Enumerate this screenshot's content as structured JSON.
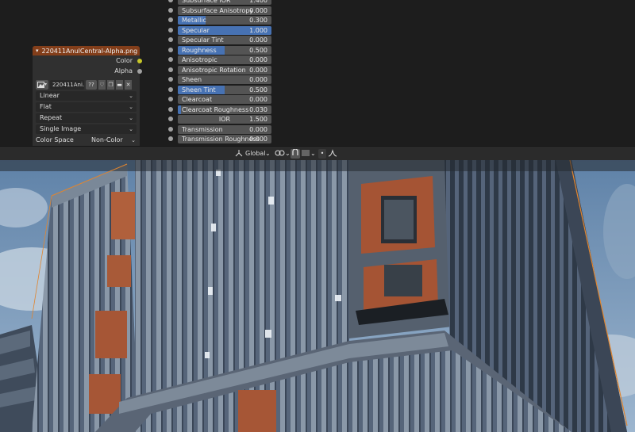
{
  "bsdf_properties": [
    {
      "label": "Subsurface IOR",
      "value": "1.400",
      "fill": 0,
      "centered": false
    },
    {
      "label": "Subsurface Anisotropy",
      "value": "0.000",
      "fill": 0,
      "centered": false
    },
    {
      "label": "Metallic",
      "value": "0.300",
      "fill": 0.3,
      "centered": false
    },
    {
      "label": "Specular",
      "value": "1.000",
      "fill": 1.0,
      "centered": false
    },
    {
      "label": "Specular Tint",
      "value": "0.000",
      "fill": 0,
      "centered": false
    },
    {
      "label": "Roughness",
      "value": "0.500",
      "fill": 0.5,
      "centered": false
    },
    {
      "label": "Anisotropic",
      "value": "0.000",
      "fill": 0,
      "centered": false
    },
    {
      "label": "Anisotropic Rotation",
      "value": "0.000",
      "fill": 0,
      "centered": false
    },
    {
      "label": "Sheen",
      "value": "0.000",
      "fill": 0,
      "centered": false
    },
    {
      "label": "Sheen Tint",
      "value": "0.500",
      "fill": 0.5,
      "centered": false
    },
    {
      "label": "Clearcoat",
      "value": "0.000",
      "fill": 0,
      "centered": false
    },
    {
      "label": "Clearcoat Roughness",
      "value": "0.030",
      "fill": 0.03,
      "centered": false
    },
    {
      "label": "IOR",
      "value": "1.500",
      "fill": 0,
      "centered": true
    },
    {
      "label": "Transmission",
      "value": "0.000",
      "fill": 0,
      "centered": false
    },
    {
      "label": "Transmission Roughness",
      "value": "0.000",
      "fill": 0,
      "centered": false
    }
  ],
  "image_node": {
    "title": "220411AnulCentral-Alpha.png",
    "outputs": {
      "color": "Color",
      "alpha": "Alpha"
    },
    "image_name": "220411Ani...",
    "users": "??",
    "interpolation": "Linear",
    "projection": "Flat",
    "extension": "Repeat",
    "source": "Single Image",
    "color_space_label": "Color Space",
    "color_space_value": "Non-Color"
  },
  "viewport_header": {
    "orientation": "Global"
  },
  "colors": {
    "accent": "#4772b3",
    "node_header": "#833e1a",
    "field": "#545454",
    "color_socket": "#c7c729",
    "selection_outline": "#e0852f"
  },
  "icons": [
    "chevron-down-icon",
    "image-icon",
    "fake-user-icon",
    "duplicate-icon",
    "folder-icon",
    "close-icon",
    "transform-orientation-icon",
    "pivot-icon",
    "snap-icon",
    "proportional-edit-icon",
    "falloff-icon"
  ]
}
